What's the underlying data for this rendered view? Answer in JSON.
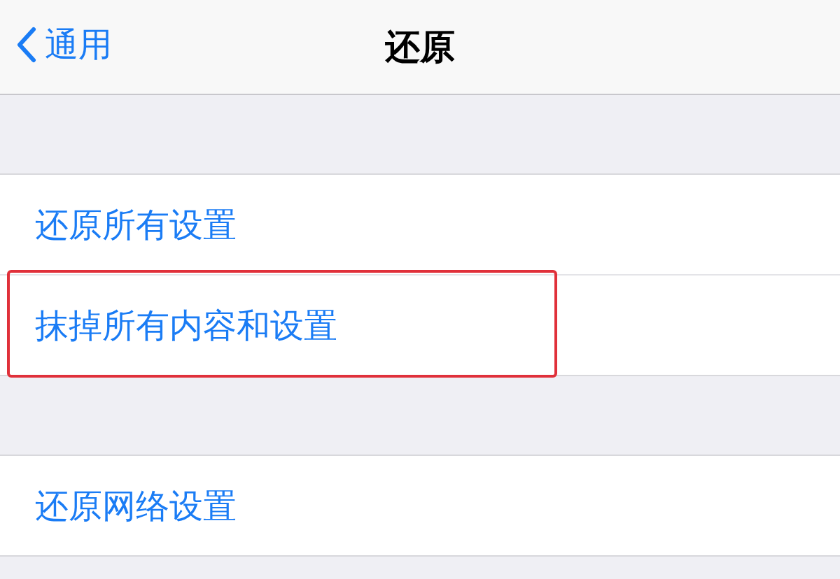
{
  "nav": {
    "back": "通用",
    "title": "还原"
  },
  "groups": [
    {
      "items": [
        {
          "label": "还原所有设置",
          "highlighted": false
        },
        {
          "label": "抹掉所有内容和设置",
          "highlighted": true
        }
      ]
    },
    {
      "items": [
        {
          "label": "还原网络设置",
          "highlighted": false
        }
      ]
    }
  ]
}
